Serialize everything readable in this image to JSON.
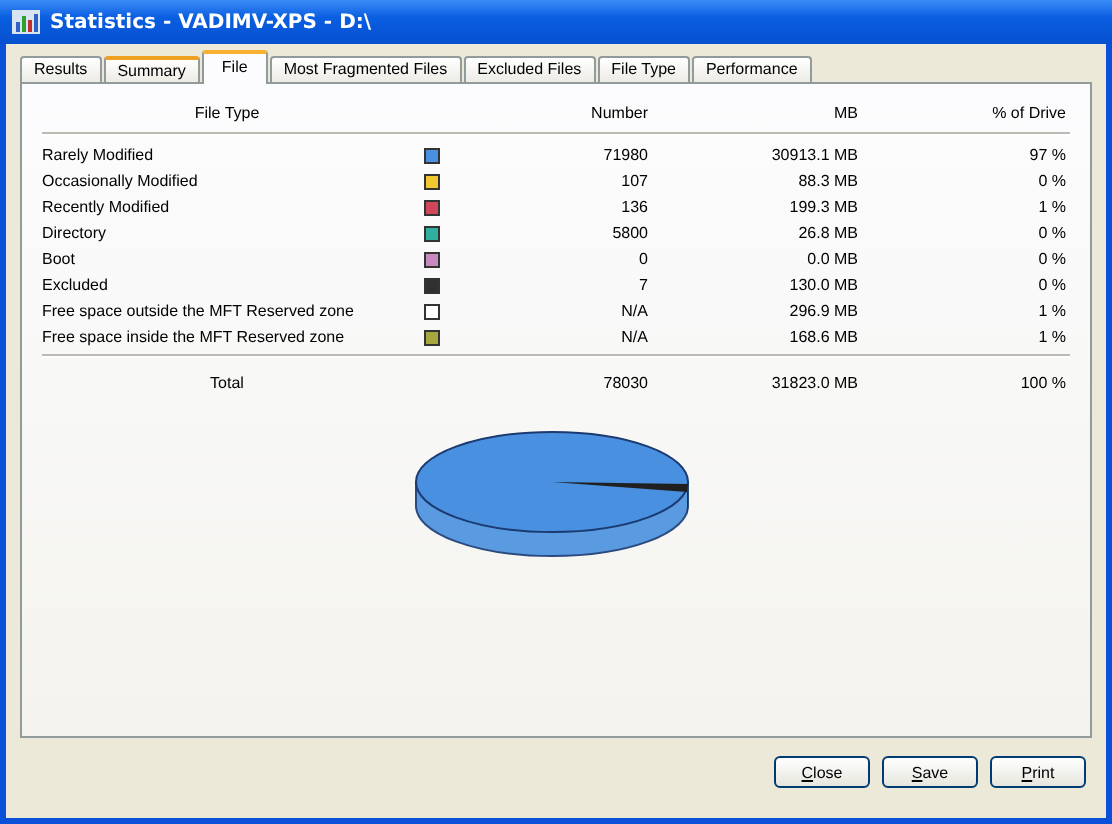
{
  "window": {
    "title": "Statistics - VADIMV-XPS - D:\\"
  },
  "tabs": [
    {
      "label": "Results",
      "selected": false,
      "hovered": false
    },
    {
      "label": "Summary",
      "selected": false,
      "hovered": true
    },
    {
      "label": "File",
      "selected": true,
      "hovered": false
    },
    {
      "label": "Most Fragmented Files",
      "selected": false,
      "hovered": false
    },
    {
      "label": "Excluded Files",
      "selected": false,
      "hovered": false
    },
    {
      "label": "File Type",
      "selected": false,
      "hovered": false
    },
    {
      "label": "Performance",
      "selected": false,
      "hovered": false
    }
  ],
  "table": {
    "columns": [
      "File Type",
      "Number",
      "MB",
      "% of Drive"
    ],
    "rows": [
      {
        "name": "Rarely Modified",
        "color": "#4a90e0",
        "number": "71980",
        "mb": "30913.1 MB",
        "percent": "97 %"
      },
      {
        "name": "Occasionally Modified",
        "color": "#f0c830",
        "number": "107",
        "mb": "88.3 MB",
        "percent": "0 %"
      },
      {
        "name": "Recently Modified",
        "color": "#d04858",
        "number": "136",
        "mb": "199.3 MB",
        "percent": "1 %"
      },
      {
        "name": "Directory",
        "color": "#30b0a0",
        "number": "5800",
        "mb": "26.8 MB",
        "percent": "0 %"
      },
      {
        "name": "Boot",
        "color": "#c888c0",
        "number": "0",
        "mb": "0.0 MB",
        "percent": "0 %"
      },
      {
        "name": "Excluded",
        "color": "#303030",
        "number": "7",
        "mb": "130.0 MB",
        "percent": "0 %"
      },
      {
        "name": "Free space outside the MFT Reserved zone",
        "color": "#ffffff",
        "number": "N/A",
        "mb": "296.9 MB",
        "percent": "1 %"
      },
      {
        "name": "Free space inside the MFT Reserved zone",
        "color": "#a8a840",
        "number": "N/A",
        "mb": "168.6 MB",
        "percent": "1 %"
      }
    ],
    "total": {
      "name": "Total",
      "number": "78030",
      "mb": "31823.0 MB",
      "percent": "100 %"
    }
  },
  "buttons": [
    "Close",
    "Save",
    "Print"
  ]
}
